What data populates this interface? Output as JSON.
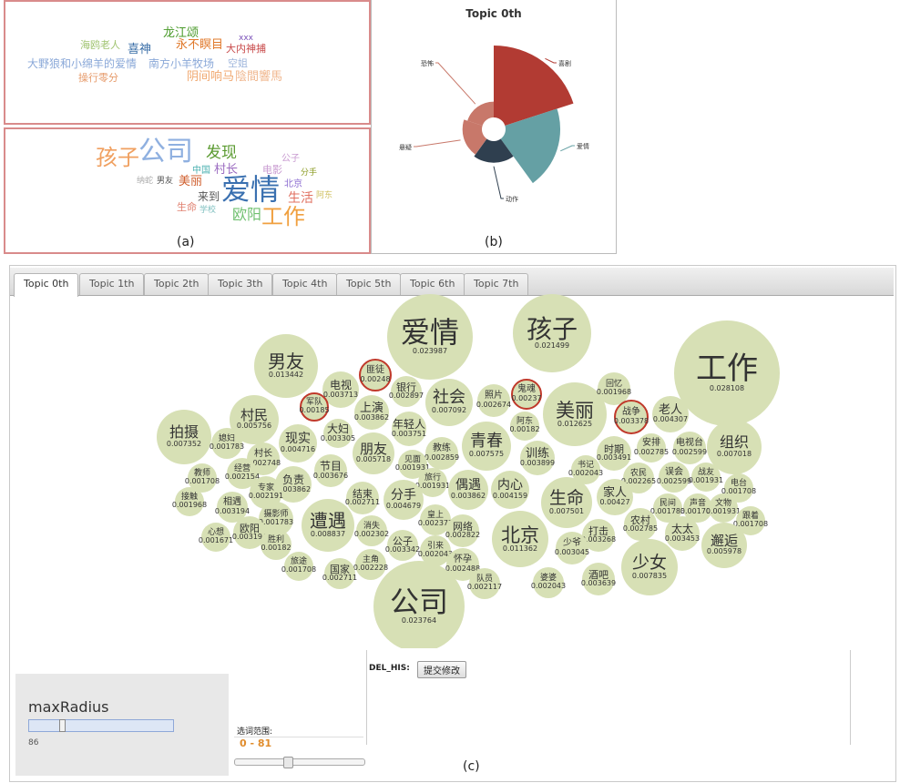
{
  "labels": {
    "a": "(a)",
    "b": "(b)",
    "c": "(c)"
  },
  "panel_a_top_words": [
    {
      "text": "龙江颂",
      "color": "#4a9a2a"
    },
    {
      "text": "xxx",
      "color": "#7b52b9"
    },
    {
      "text": "海鸥老人",
      "color": "#9fc36f"
    },
    {
      "text": "喜神",
      "color": "#3b6fa8"
    },
    {
      "text": "永不瞑目",
      "color": "#e0782a"
    },
    {
      "text": "大内神捕",
      "color": "#c84a4a"
    },
    {
      "text": "大野狼和小绵羊的爱情",
      "color": "#8aa8d8"
    },
    {
      "text": "南方小羊牧场",
      "color": "#8aa8d8"
    },
    {
      "text": "空姐",
      "color": "#9fb6dc"
    },
    {
      "text": "操行零分",
      "color": "#e69a6a"
    },
    {
      "text": "阴间响马",
      "color": "#f0a870"
    },
    {
      "text": "陰間響馬",
      "color": "#f0b890"
    }
  ],
  "panel_a_bottom_words": [
    {
      "text": "孩子",
      "color": "#f0a060"
    },
    {
      "text": "公司",
      "color": "#8fb0e0"
    },
    {
      "text": "发现",
      "color": "#5a9a30"
    },
    {
      "text": "公子",
      "color": "#c89ad0"
    },
    {
      "text": "中国",
      "color": "#4ab0b0"
    },
    {
      "text": "村长",
      "color": "#9a6ac0"
    },
    {
      "text": "电影",
      "color": "#c89ad0"
    },
    {
      "text": "分手",
      "color": "#8a9a20"
    },
    {
      "text": "纳蛇",
      "color": "#aaaaaa"
    },
    {
      "text": "男友",
      "color": "#555555"
    },
    {
      "text": "美丽",
      "color": "#d06030"
    },
    {
      "text": "爱情",
      "color": "#3a70b0"
    },
    {
      "text": "北京",
      "color": "#8a6ad0"
    },
    {
      "text": "来到",
      "color": "#555555"
    },
    {
      "text": "生活",
      "color": "#e07060"
    },
    {
      "text": "阿东",
      "color": "#d0c060"
    },
    {
      "text": "生命",
      "color": "#e08070"
    },
    {
      "text": "学校",
      "color": "#80c0c0"
    },
    {
      "text": "欧阳",
      "color": "#70c070"
    },
    {
      "text": "工作",
      "color": "#f0a040"
    }
  ],
  "panel_b": {
    "title": "Topic 0th",
    "chart_data": {
      "type": "nightingale-rose",
      "title": "Topic 0th",
      "slices": [
        {
          "name": "喜剧",
          "value": 100,
          "color": "#b23b33"
        },
        {
          "name": "爱情",
          "value": 76,
          "color": "#65a0a4"
        },
        {
          "name": "动作",
          "value": 30,
          "color": "#2f3f4f"
        },
        {
          "name": "悬疑",
          "value": 27,
          "color": "#c8786a"
        },
        {
          "name": "恐怖",
          "value": 22,
          "color": "#c8786a"
        }
      ]
    }
  },
  "tabs": [
    "Topic 0th",
    "Topic 1th",
    "Topic 2th",
    "Topic 3th",
    "Topic 4th",
    "Topic 5th",
    "Topic 6th",
    "Topic 7th"
  ],
  "active_tab": 0,
  "bubbles": [
    {
      "w": "爱情",
      "v": "0.023987"
    },
    {
      "w": "孩子",
      "v": "0.021499"
    },
    {
      "w": "工作",
      "v": "0.028108"
    },
    {
      "w": "男友",
      "v": "0.013442"
    },
    {
      "w": "电视",
      "v": "0.003713"
    },
    {
      "w": "匪徒",
      "v": "0.00248"
    },
    {
      "w": "银行",
      "v": "0.002897"
    },
    {
      "w": "社会",
      "v": "0.007092"
    },
    {
      "w": "照片",
      "v": "0.002674"
    },
    {
      "w": "鬼魂",
      "v": "0.00237"
    },
    {
      "w": "美丽",
      "v": "0.012625"
    },
    {
      "w": "回忆",
      "v": "0.001968"
    },
    {
      "w": "战争",
      "v": "0.003378"
    },
    {
      "w": "老人",
      "v": "0.004307"
    },
    {
      "w": "村民",
      "v": "0.005756"
    },
    {
      "w": "军队",
      "v": "0.00185"
    },
    {
      "w": "上演",
      "v": "0.003862"
    },
    {
      "w": "年轻人",
      "v": "0.003751"
    },
    {
      "w": "阿东",
      "v": "0.00182"
    },
    {
      "w": "青春",
      "v": "0.007575"
    },
    {
      "w": "组织",
      "v": "0.007018"
    },
    {
      "w": "拍摄",
      "v": "0.007352"
    },
    {
      "w": "媳妇",
      "v": "0.001783"
    },
    {
      "w": "现实",
      "v": "0.004716"
    },
    {
      "w": "大妇",
      "v": "0.003305"
    },
    {
      "w": "朋友",
      "v": "0.005718"
    },
    {
      "w": "教练",
      "v": "0.002859"
    },
    {
      "w": "训练",
      "v": "0.003899"
    },
    {
      "w": "时期",
      "v": "0.003491"
    },
    {
      "w": "安排",
      "v": "0.002785"
    },
    {
      "w": "电视台",
      "v": "0.002599"
    },
    {
      "w": "村长",
      "v": "0.002748"
    },
    {
      "w": "见面",
      "v": "0.001931"
    },
    {
      "w": "书记",
      "v": "0.002043"
    },
    {
      "w": "教师",
      "v": "0.001708"
    },
    {
      "w": "经营",
      "v": "0.002154"
    },
    {
      "w": "负责",
      "v": "0.003862"
    },
    {
      "w": "节目",
      "v": "0.003676"
    },
    {
      "w": "旅行",
      "v": "0.001931"
    },
    {
      "w": "偶遇",
      "v": "0.003862"
    },
    {
      "w": "内心",
      "v": "0.004159"
    },
    {
      "w": "农民",
      "v": "0.002265"
    },
    {
      "w": "误会",
      "v": "0.002599"
    },
    {
      "w": "战友",
      "v": "0.001931"
    },
    {
      "w": "电台",
      "v": "0.001708"
    },
    {
      "w": "专家",
      "v": "0.002191"
    },
    {
      "w": "接触",
      "v": "0.001968"
    },
    {
      "w": "相遇",
      "v": "0.003194"
    },
    {
      "w": "结束",
      "v": "0.002711"
    },
    {
      "w": "分手",
      "v": "0.004679"
    },
    {
      "w": "生命",
      "v": "0.007501"
    },
    {
      "w": "家人",
      "v": "0.00427"
    },
    {
      "w": "民间",
      "v": "0.001783"
    },
    {
      "w": "声音",
      "v": "0.001708"
    },
    {
      "w": "文物",
      "v": "0.001931"
    },
    {
      "w": "遭遇",
      "v": "0.008837"
    },
    {
      "w": "摄影师",
      "v": "0.001783"
    },
    {
      "w": "皇上",
      "v": "0.002377"
    },
    {
      "w": "跟着",
      "v": "0.001708"
    },
    {
      "w": "心想",
      "v": "0.001671"
    },
    {
      "w": "欧阳",
      "v": "0.003194"
    },
    {
      "w": "消失",
      "v": "0.002302"
    },
    {
      "w": "网络",
      "v": "0.002822"
    },
    {
      "w": "北京",
      "v": "0.011362"
    },
    {
      "w": "农村",
      "v": "0.002785"
    },
    {
      "w": "太太",
      "v": "0.003453"
    },
    {
      "w": "公子",
      "v": "0.003342"
    },
    {
      "w": "打击",
      "v": "0.003268"
    },
    {
      "w": "邂逅",
      "v": "0.005978"
    },
    {
      "w": "胜利",
      "v": "0.00182"
    },
    {
      "w": "引来",
      "v": "0.002043"
    },
    {
      "w": "少爷",
      "v": "0.003045"
    },
    {
      "w": "旅途",
      "v": "0.001708"
    },
    {
      "w": "主角",
      "v": "0.002228"
    },
    {
      "w": "怀孕",
      "v": "0.002488"
    },
    {
      "w": "少女",
      "v": "0.007835"
    },
    {
      "w": "国家",
      "v": "0.002711"
    },
    {
      "w": "酒吧",
      "v": "0.003639"
    },
    {
      "w": "婆婆",
      "v": "0.002043"
    },
    {
      "w": "队员",
      "v": "0.002117"
    },
    {
      "w": "公司",
      "v": "0.023764"
    }
  ],
  "controls": {
    "max_radius_label": "maxRadius",
    "max_radius_value": "86",
    "range_label": "选词范围:",
    "range_value": "0 - 81",
    "del_his_label": "DEL_HIS:",
    "submit_label": "提交修改"
  }
}
